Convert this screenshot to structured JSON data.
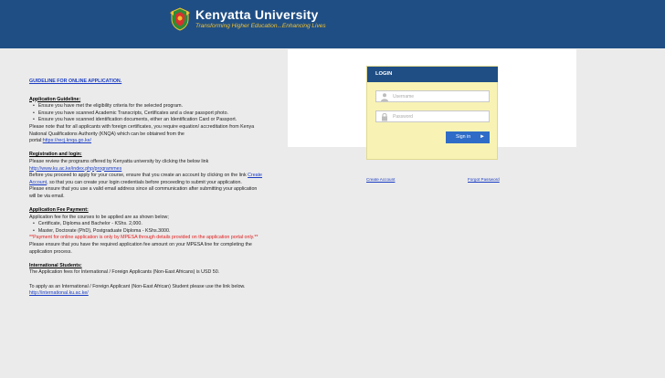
{
  "header": {
    "logo_title": "Kenyatta University",
    "logo_tagline": "Transforming Higher Education...Enhancing Lives"
  },
  "guide": {
    "main_heading": "GUIDELINE FOR ONLINE APPLICATION.",
    "app_guideline": {
      "heading": "Application Guideline:",
      "bullets": [
        "Ensure you have met the eligibility criteria for the selected program.",
        "Ensure you have scanned Academic Transcripts, Certificates and a clear passport photo.",
        "Ensure you have scanned identification documents, either an Identification Card or Passport."
      ],
      "note": "Please note that for all applicants with foreign certificates, you require equation/ accreditation from Kenya National Qualifications Authority (KNQA) which can be obtained from the",
      "portal_prefix": "portal:",
      "portal_link": "https://recj.knqa.go.ke/"
    },
    "registration": {
      "heading": "Registration and login:",
      "line1": "Please review the programs offered by Kenyatta university by clicking the below link",
      "programmes_link": "http://www.ku.ac.ke/index.php/programmes",
      "line2a": "Before you proceed to apply for your course, ensure that you create an account by clicking on the link",
      "create_account_link": "Create Account",
      "line2b": ", so that you can create your login credentials before proceeding to submit your application.",
      "line3": "Please ensure that you use a valid email address since all communication after submitting your application will be via email."
    },
    "fee": {
      "heading": "Application Fee Payment:",
      "intro": "Application fee for the courses to be applied are as shown below;",
      "bullets": [
        "Certificate, Diploma and Bachelor - KShs. 2,000.",
        "Master, Doctorate (PhD), Postgraduate Diploma - KShs.3000."
      ],
      "warning": "**Payment for online application is only by MPESA through details provided on the application portal only.**",
      "note": "Please ensure that you have the required application fee amount on your MPESA line for completing the application process."
    },
    "international": {
      "heading": "International Students:",
      "line1": "The Application fees for International / Foreign Applicants (Non-East Africans) is USD 50.",
      "line2": "To apply as an International / Foreign Applicant (Non-East African) Student please use the link below.",
      "link": "http://international.ku.ac.ke/"
    }
  },
  "login": {
    "title": "LOGIN",
    "username_placeholder": "Username",
    "password_placeholder": "Password",
    "signin_label": "Sign in",
    "create_account": "Create Account",
    "forgot_password": "Forgot Password"
  },
  "colors": {
    "header_bg": "#1f4e84",
    "login_box_bg": "#f8f3b4",
    "link": "#1a3cc2",
    "warning": "#e21b1b",
    "signin_bg": "#2f6cc8"
  }
}
